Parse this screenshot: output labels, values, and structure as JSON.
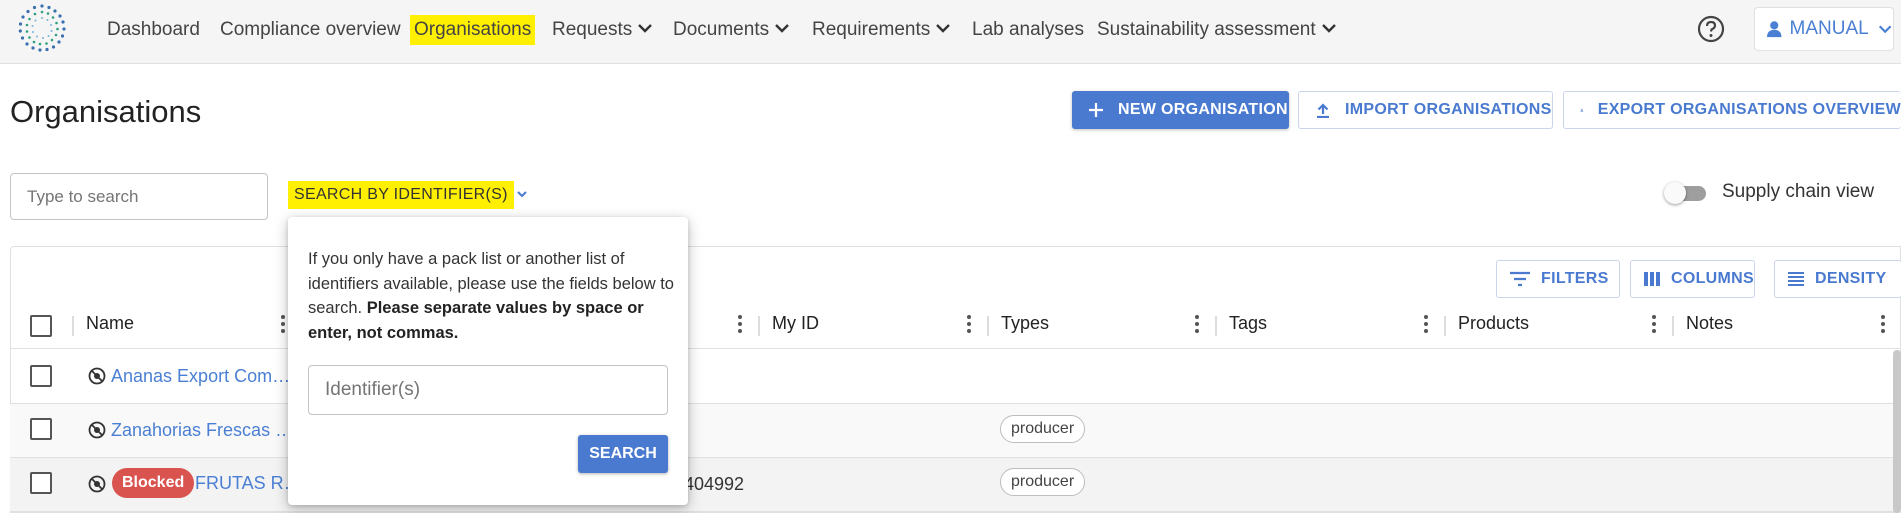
{
  "nav": {
    "items": [
      {
        "label": "Dashboard"
      },
      {
        "label": "Compliance overview"
      },
      {
        "label": "Organisations"
      },
      {
        "label": "Requests"
      },
      {
        "label": "Documents"
      },
      {
        "label": "Requirements"
      },
      {
        "label": "Lab analyses"
      },
      {
        "label": "Sustainability assessment"
      }
    ],
    "user_label": "MANUAL"
  },
  "page": {
    "title": "Organisations",
    "new_button": "NEW ORGANISATION",
    "import_button": "IMPORT ORGANISATIONS",
    "export_button": "EXPORT ORGANISATIONS OVERVIEW"
  },
  "search": {
    "placeholder": "Type to search",
    "by_identifier_label": "SEARCH BY IDENTIFIER(S)",
    "supply_chain_label": "Supply chain view"
  },
  "toolbar": {
    "filters": "FILTERS",
    "columns": "COLUMNS",
    "density": "DENSITY"
  },
  "columns": [
    "Name",
    "My ID",
    "Types",
    "Tags",
    "Products",
    "Notes"
  ],
  "rows": [
    {
      "name": "Ananas Export Com…",
      "blocked": "",
      "id_fragment": "",
      "type": ""
    },
    {
      "name": "Zanahorias Frescas …",
      "blocked": "",
      "id_fragment": "",
      "type": "producer"
    },
    {
      "name": "FRUTAS R…",
      "blocked": "Blocked",
      "id_fragment": "404992",
      "type": "producer"
    }
  ],
  "popover": {
    "text": "If you only have a pack list or another list of identifiers available, please use the fields below to search.",
    "bold_text": "Please separate values by space or enter, not commas.",
    "input_placeholder": "Identifier(s)",
    "search_button": "SEARCH"
  },
  "colors": {
    "primary": "#4a7ad0",
    "link": "#4a7fd4",
    "highlight": "#ffef00",
    "blocked": "#d9534f"
  }
}
